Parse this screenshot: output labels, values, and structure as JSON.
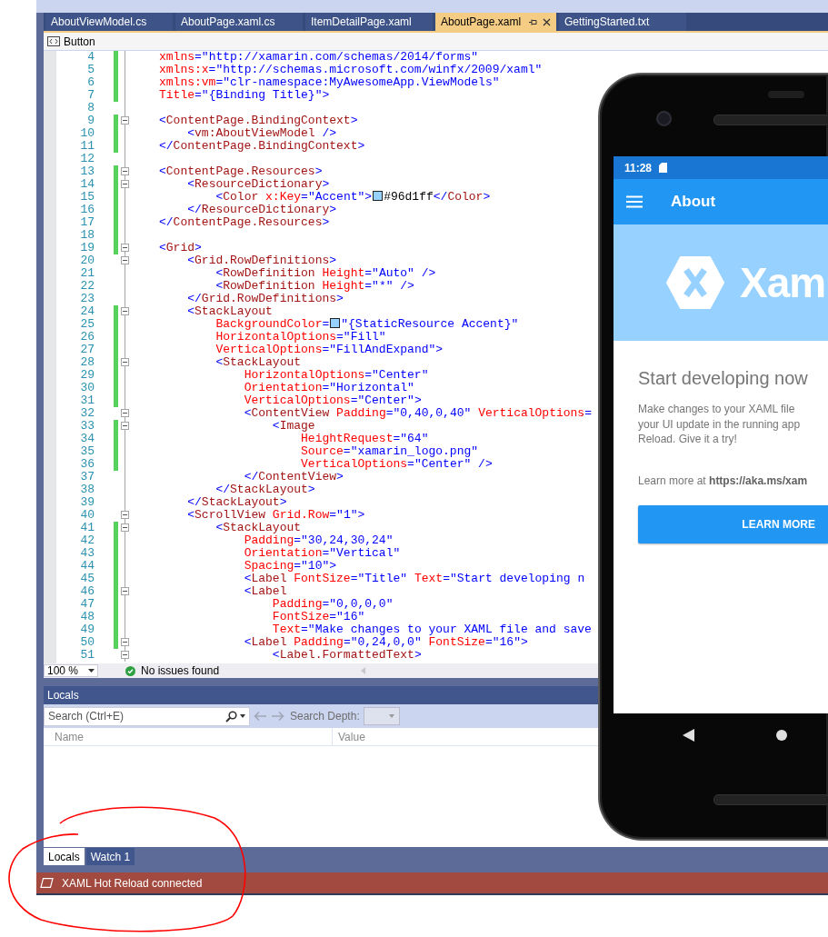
{
  "tabs": [
    {
      "label": "AboutViewModel.cs",
      "selected": false
    },
    {
      "label": "AboutPage.xaml.cs",
      "selected": false
    },
    {
      "label": "ItemDetailPage.xaml",
      "selected": false
    },
    {
      "label": "AboutPage.xaml",
      "selected": true
    },
    {
      "label": "GettingStarted.txt",
      "selected": false
    }
  ],
  "navigation_bar": {
    "member": "Button"
  },
  "editor": {
    "lines": [
      {
        "number": "4",
        "changed": true,
        "collapsible": false,
        "code": [
          "xmlns=\"http://xamarin.com/schemas/2014/forms\""
        ]
      },
      {
        "number": "5",
        "changed": true,
        "collapsible": false,
        "code": [
          "xmlns:x=\"http://schemas.microsoft.com/winfx/2009/xaml\""
        ]
      },
      {
        "number": "6",
        "changed": true,
        "collapsible": false,
        "code": [
          "xmlns:vm=\"clr-namespace:MyAwesomeApp.ViewModels\""
        ]
      },
      {
        "number": "7",
        "changed": true,
        "collapsible": false,
        "code": [
          "Title=\"{Binding Title}\">"
        ]
      },
      {
        "number": "8",
        "changed": false,
        "collapsible": false
      },
      {
        "number": "9",
        "changed": true,
        "collapsible": true,
        "code": [
          "<ContentPage.BindingContext>"
        ]
      },
      {
        "number": "10",
        "changed": true,
        "collapsible": false,
        "code": [
          "    <vm:AboutViewModel />"
        ]
      },
      {
        "number": "11",
        "changed": true,
        "collapsible": false,
        "code": [
          "</ContentPage.BindingContext>"
        ]
      },
      {
        "number": "12",
        "changed": false,
        "collapsible": false
      },
      {
        "number": "13",
        "changed": true,
        "collapsible": true,
        "code": [
          "<ContentPage.Resources>"
        ]
      },
      {
        "number": "14",
        "changed": true,
        "collapsible": true,
        "code": [
          "    <ResourceDictionary>"
        ]
      },
      {
        "number": "15",
        "changed": true,
        "collapsible": false,
        "code": [
          "        <Color x:Key=\"Accent\">",
          "#96d1ff</Color>"
        ],
        "color": "#96d1ff"
      },
      {
        "number": "16",
        "changed": true,
        "collapsible": false,
        "code": [
          "    </ResourceDictionary>"
        ]
      },
      {
        "number": "17",
        "changed": true,
        "collapsible": false,
        "code": [
          "</ContentPage.Resources>"
        ]
      },
      {
        "number": "18",
        "changed": true,
        "collapsible": false
      },
      {
        "number": "19",
        "changed": true,
        "collapsible": true,
        "code": [
          "<Grid>"
        ]
      },
      {
        "number": "20",
        "changed": false,
        "collapsible": true,
        "code": [
          "    <Grid.RowDefinitions>"
        ]
      },
      {
        "number": "21",
        "changed": false,
        "collapsible": false,
        "code": [
          "        <RowDefinition Height=\"Auto\" />"
        ]
      },
      {
        "number": "22",
        "changed": false,
        "collapsible": false,
        "code": [
          "        <RowDefinition Height=\"*\" />"
        ]
      },
      {
        "number": "23",
        "changed": false,
        "collapsible": false,
        "code": [
          "    </Grid.RowDefinitions>"
        ]
      },
      {
        "number": "24",
        "changed": true,
        "collapsible": true,
        "code": [
          "    <StackLayout"
        ]
      },
      {
        "number": "25",
        "changed": true,
        "collapsible": false,
        "code": [
          "        BackgroundColor=",
          "\"{StaticResource Accent}\""
        ],
        "color": "#96d1ff"
      },
      {
        "number": "26",
        "changed": true,
        "collapsible": false,
        "code": [
          "        HorizontalOptions=\"Fill\""
        ]
      },
      {
        "number": "27",
        "changed": true,
        "collapsible": false,
        "code": [
          "        VerticalOptions=\"FillAndExpand\">"
        ]
      },
      {
        "number": "28",
        "changed": true,
        "collapsible": true,
        "code": [
          "        <StackLayout"
        ]
      },
      {
        "number": "29",
        "changed": true,
        "collapsible": false,
        "code": [
          "            HorizontalOptions=\"Center\""
        ]
      },
      {
        "number": "30",
        "changed": true,
        "collapsible": false,
        "code": [
          "            Orientation=\"Horizontal\""
        ]
      },
      {
        "number": "31",
        "changed": true,
        "collapsible": false,
        "code": [
          "            VerticalOptions=\"Center\">"
        ]
      },
      {
        "number": "32",
        "changed": false,
        "collapsible": true,
        "code": [
          "            <ContentView Padding=\"0,40,0,40\" VerticalOptions="
        ]
      },
      {
        "number": "33",
        "changed": true,
        "collapsible": true,
        "code": [
          "                <Image"
        ]
      },
      {
        "number": "34",
        "changed": true,
        "collapsible": false,
        "code": [
          "                    HeightRequest=\"64\""
        ]
      },
      {
        "number": "35",
        "changed": true,
        "collapsible": false,
        "code": [
          "                    Source=\"xamarin_logo.png\""
        ]
      },
      {
        "number": "36",
        "changed": true,
        "collapsible": false,
        "code": [
          "                    VerticalOptions=\"Center\" />"
        ]
      },
      {
        "number": "37",
        "changed": false,
        "collapsible": false,
        "code": [
          "            </ContentView>"
        ]
      },
      {
        "number": "38",
        "changed": false,
        "collapsible": false,
        "code": [
          "        </StackLayout>"
        ]
      },
      {
        "number": "39",
        "changed": false,
        "collapsible": false,
        "code": [
          "    </StackLayout>"
        ]
      },
      {
        "number": "40",
        "changed": false,
        "collapsible": true,
        "code": [
          "    <ScrollView Grid.Row=\"1\">"
        ]
      },
      {
        "number": "41",
        "changed": true,
        "collapsible": true,
        "code": [
          "        <StackLayout"
        ]
      },
      {
        "number": "42",
        "changed": true,
        "collapsible": false,
        "code": [
          "            Padding=\"30,24,30,24\""
        ]
      },
      {
        "number": "43",
        "changed": true,
        "collapsible": false,
        "code": [
          "            Orientation=\"Vertical\""
        ]
      },
      {
        "number": "44",
        "changed": true,
        "collapsible": false,
        "code": [
          "            Spacing=\"10\">"
        ]
      },
      {
        "number": "45",
        "changed": true,
        "collapsible": false,
        "code": [
          "            <Label FontSize=\"Title\" Text=\"Start developing n"
        ]
      },
      {
        "number": "46",
        "changed": true,
        "collapsible": true,
        "code": [
          "            <Label"
        ]
      },
      {
        "number": "47",
        "changed": true,
        "collapsible": false,
        "code": [
          "                Padding=\"0,0,0,0\""
        ]
      },
      {
        "number": "48",
        "changed": true,
        "collapsible": false,
        "code": [
          "                FontSize=\"16\""
        ]
      },
      {
        "number": "49",
        "changed": true,
        "collapsible": false,
        "code": [
          "                Text=\"Make changes to your XAML file and save"
        ]
      },
      {
        "number": "50",
        "changed": true,
        "collapsible": true,
        "code": [
          "            <Label Padding=\"0,24,0,0\" FontSize=\"16\">"
        ]
      },
      {
        "number": "51",
        "changed": false,
        "collapsible": true,
        "code": [
          "                <Label.FormattedText>"
        ]
      }
    ],
    "zoom": "100 %",
    "issues": "No issues found"
  },
  "locals_panel": {
    "title": "Locals",
    "search": {
      "placeholder": "Search (Ctrl+E)"
    },
    "search_depth_label": "Search Depth:",
    "columns": [
      "Name",
      "Value"
    ],
    "tabs": [
      {
        "label": "Locals",
        "selected": true
      },
      {
        "label": "Watch 1",
        "selected": false
      }
    ]
  },
  "status_bar": {
    "message": "XAML Hot Reload connected"
  },
  "phone_preview": {
    "time": "11:28",
    "title": "About",
    "logo_text": "Xam",
    "heading": "Start developing now",
    "body_lines": [
      "Make changes to your XAML file",
      "your UI update in the running app",
      "Reload. Give it a try!"
    ],
    "learn_more": "Learn more at **https://aka.ms/xam**",
    "button": "LEARN MORE"
  }
}
